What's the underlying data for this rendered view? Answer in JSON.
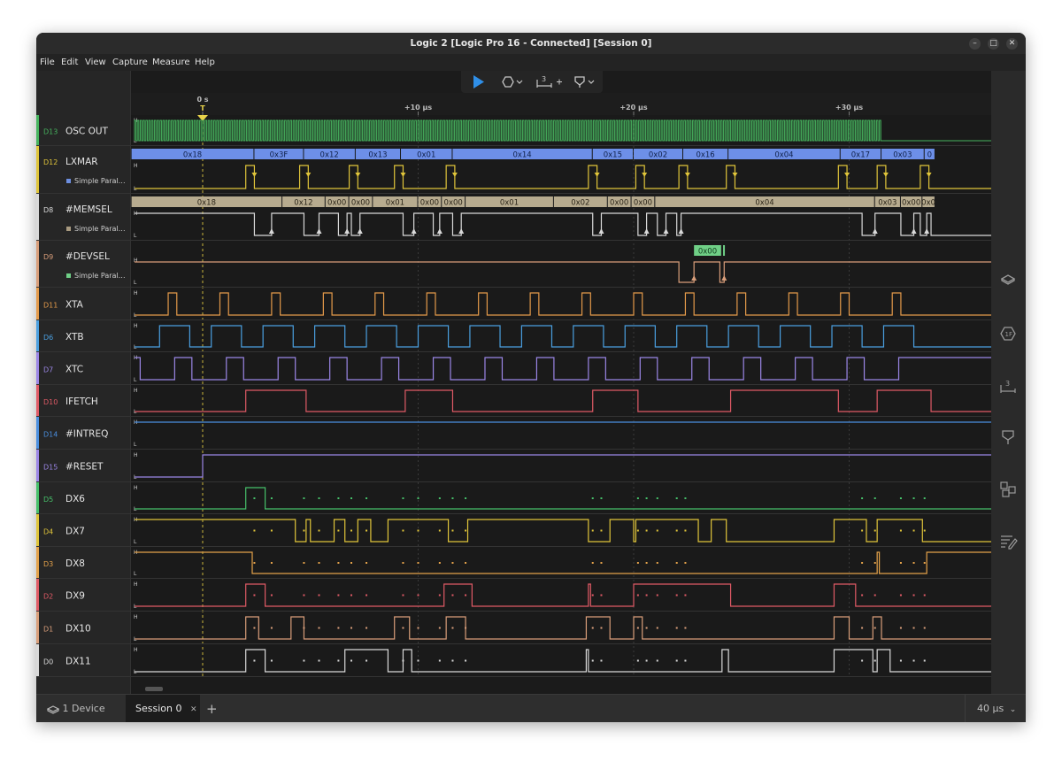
{
  "window": {
    "title": "Logic 2 [Logic Pro 16 - Connected] [Session 0]"
  },
  "menu": [
    "File",
    "Edit",
    "View",
    "Capture",
    "Measure",
    "Help"
  ],
  "toolbar": {
    "timing_marker_label": "3"
  },
  "timeline": {
    "labels": [
      {
        "t": 0,
        "label": "0 s"
      },
      {
        "t": 10,
        "label": "+10 µs"
      },
      {
        "t": 20,
        "label": "+20 µs"
      },
      {
        "t": 30,
        "label": "+30 µs"
      }
    ],
    "trigger_label": "T"
  },
  "channels": [
    {
      "id": "D13",
      "name": "OSC OUT",
      "color": "#46b45e"
    },
    {
      "id": "D12",
      "name": "LXMAR",
      "color": "#e0c53a",
      "analyzer": "Simple Parallel",
      "analyzer_color": "#5b8fe8",
      "analyzer_label_color": "#6d8fe0"
    },
    {
      "id": "D8",
      "name": "#MEMSEL",
      "color": "#d9d9d9",
      "analyzer": "Simple Parallel",
      "analyzer_color": "#b7ab8f",
      "analyzer_label_color": "#a89a80"
    },
    {
      "id": "D9",
      "name": "#DEVSEL",
      "color": "#d99e7a",
      "analyzer": "Simple Parallel",
      "analyzer_color": "#6fcf86",
      "analyzer_label_color": "#6fcf86"
    },
    {
      "id": "D11",
      "name": "XTA",
      "color": "#e49a4a"
    },
    {
      "id": "D6",
      "name": "XTB",
      "color": "#4a9fe0"
    },
    {
      "id": "D7",
      "name": "XTC",
      "color": "#9b86e6"
    },
    {
      "id": "D10",
      "name": "IFETCH",
      "color": "#e05a66"
    },
    {
      "id": "D14",
      "name": "#INTREQ",
      "color": "#4a8fe0"
    },
    {
      "id": "D15",
      "name": "#RESET",
      "color": "#9b86e6"
    },
    {
      "id": "D5",
      "name": "DX6",
      "color": "#46c06a"
    },
    {
      "id": "D4",
      "name": "DX7",
      "color": "#e0c53a"
    },
    {
      "id": "D3",
      "name": "DX8",
      "color": "#e4a24a"
    },
    {
      "id": "D2",
      "name": "DX9",
      "color": "#e05a66"
    },
    {
      "id": "D1",
      "name": "DX10",
      "color": "#d99e7a"
    },
    {
      "id": "D0",
      "name": "DX11",
      "color": "#d9d9d9"
    }
  ],
  "protocol": {
    "lxmar": [
      {
        "label": "0x18"
      },
      {
        "label": "0x3F"
      },
      {
        "label": "0x12"
      },
      {
        "label": "0x13"
      },
      {
        "label": "0x01"
      },
      {
        "label": "0x14"
      },
      {
        "label": "0x15"
      },
      {
        "label": "0x02"
      },
      {
        "label": "0x16"
      },
      {
        "label": "0x04"
      },
      {
        "label": "0x17"
      },
      {
        "label": "0x03"
      },
      {
        "label": "0"
      }
    ],
    "memsel": [
      {
        "label": "0x18"
      },
      {
        "label": "0x12"
      },
      {
        "label": "0x00"
      },
      {
        "label": "0x00"
      },
      {
        "label": "0x01"
      },
      {
        "label": "0x00"
      },
      {
        "label": "0x00"
      },
      {
        "label": "0x01"
      },
      {
        "label": "0x02"
      },
      {
        "label": "0x00"
      },
      {
        "label": "0x00"
      },
      {
        "label": "0x04"
      },
      {
        "label": "0x03"
      },
      {
        "label": "0x00"
      },
      {
        "label": "0x0"
      }
    ],
    "devsel": [
      {
        "label": "0x00"
      }
    ]
  },
  "bottom": {
    "device_label": "1 Device",
    "session_label": "Session 0",
    "zoom_label": "40 µs"
  }
}
